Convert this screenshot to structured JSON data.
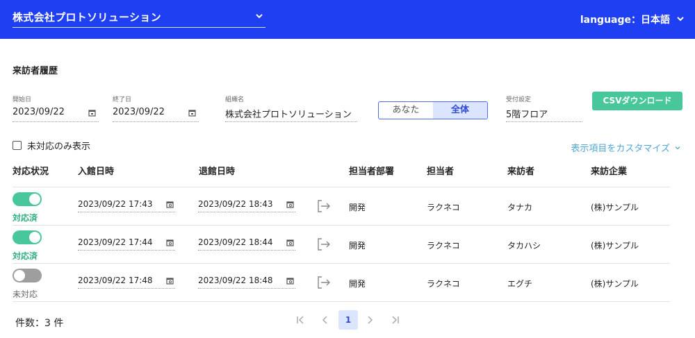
{
  "header": {
    "company": "株式会社プロトソリューション",
    "language": "language：日本語"
  },
  "page": {
    "title": "来訪者履歴"
  },
  "filters": {
    "start_date": {
      "label": "開始日",
      "value": "2023/09/22"
    },
    "end_date": {
      "label": "終了日",
      "value": "2023/09/22"
    },
    "organization": {
      "label": "組織名",
      "value": "株式会社プロトソリューション"
    },
    "scope_toggle": {
      "options": [
        "あなた",
        "全体"
      ],
      "selected": "全体"
    },
    "reception": {
      "label": "受付設定",
      "value": "5階フロア"
    },
    "csv_button": "CSVダウンロード",
    "unhandled_only": "未対応のみ表示",
    "customize": "表示項目をカスタマイズ"
  },
  "table": {
    "columns": [
      "対応状況",
      "入館日時",
      "退館日時",
      "担当者部署",
      "担当者",
      "来訪者",
      "来訪企業"
    ],
    "rows": [
      {
        "status": "対応済",
        "handled": true,
        "checkin": "2023/09/22 17:43",
        "checkout": "2023/09/22 18:43",
        "department": "開発",
        "host": "ラクネコ",
        "visitor": "タナカ",
        "company": "(株)サンプル"
      },
      {
        "status": "対応済",
        "handled": true,
        "checkin": "2023/09/22 17:44",
        "checkout": "2023/09/22 18:44",
        "department": "開発",
        "host": "ラクネコ",
        "visitor": "タカハシ",
        "company": "(株)サンプル"
      },
      {
        "status": "未対応",
        "handled": false,
        "checkin": "2023/09/22 17:48",
        "checkout": "2023/09/22 18:48",
        "department": "開発",
        "host": "ラクネコ",
        "visitor": "エグチ",
        "company": "(株)サンプル"
      }
    ]
  },
  "footer": {
    "count": "件数：3 件",
    "current_page": "1"
  },
  "colors": {
    "header_bg": "#1f3ff2",
    "accent_green": "#47c79a",
    "link_blue": "#4fa6d8",
    "toggle_active": "#dbe5ff"
  },
  "icons": [
    "chevron-down-icon",
    "calendar-icon",
    "exit-arrow-icon",
    "first-page-icon",
    "prev-page-icon",
    "next-page-icon",
    "last-page-icon"
  ]
}
